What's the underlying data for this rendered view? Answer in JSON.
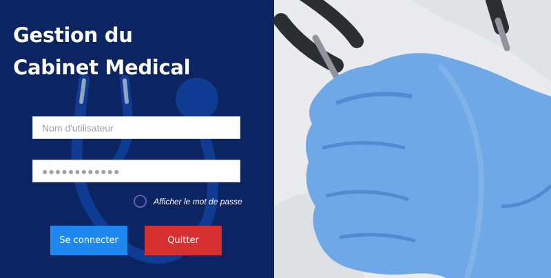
{
  "app": {
    "title_line1": "Gestion du",
    "title_line2": "Cabinet Medical"
  },
  "login": {
    "username_placeholder": "Nom d'utilisateur",
    "username_value": "",
    "password_value": "●●●●●●●●●●●●",
    "show_password_label": "Afficher le mot de passe",
    "show_password_checked": false
  },
  "buttons": {
    "connect_label": "Se connecter",
    "quit_label": "Quitter"
  },
  "colors": {
    "panel_background": "#0c2461",
    "connect_button": "#1e88f0",
    "quit_button": "#d63031",
    "glove": "#6ea8e6"
  },
  "icons": {
    "background_illustration": "stethoscope-icon",
    "photo": "gloved-hand-stethoscope-photo"
  }
}
